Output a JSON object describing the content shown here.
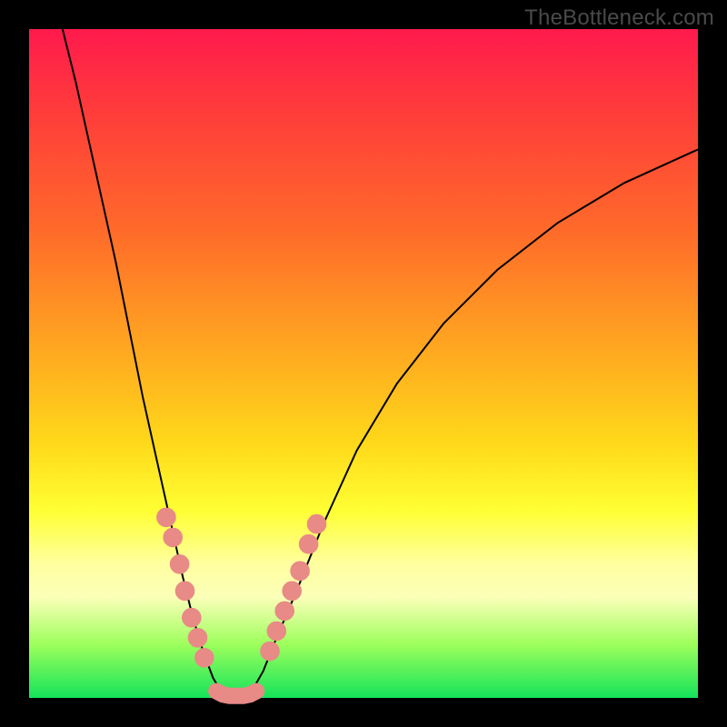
{
  "watermark": "TheBottleneck.com",
  "colors": {
    "frame": "#000000",
    "gradient_top": "#ff1a4d",
    "gradient_mid": "#ffd91a",
    "gradient_bottom": "#14e35a",
    "curve": "#000000",
    "dots": "#e88a86"
  },
  "chart_data": {
    "type": "line",
    "title": "",
    "xlabel": "",
    "ylabel": "",
    "xlim": [
      0,
      100
    ],
    "ylim": [
      0,
      100
    ],
    "series": [
      {
        "name": "left-curve",
        "x": [
          5,
          7,
          9,
          11,
          13,
          15,
          17,
          19,
          21,
          23,
          24.5,
          26,
          27.5,
          29
        ],
        "y": [
          100,
          92,
          83,
          74,
          65,
          55,
          45,
          36,
          27,
          18,
          12,
          7,
          3,
          0.5
        ]
      },
      {
        "name": "right-curve",
        "x": [
          33,
          35,
          37,
          40,
          44,
          49,
          55,
          62,
          70,
          79,
          89,
          100
        ],
        "y": [
          0.5,
          4,
          9,
          16,
          26,
          37,
          47,
          56,
          64,
          71,
          77,
          82
        ]
      }
    ],
    "valley_floor": {
      "x": [
        28,
        29,
        30,
        31,
        32,
        33,
        34
      ],
      "y": [
        1,
        0.5,
        0.3,
        0.3,
        0.3,
        0.5,
        1
      ]
    },
    "highlight_dots_left": [
      {
        "x": 20.5,
        "y": 27
      },
      {
        "x": 21.5,
        "y": 24
      },
      {
        "x": 22.5,
        "y": 20
      },
      {
        "x": 23.3,
        "y": 16
      },
      {
        "x": 24.3,
        "y": 12
      },
      {
        "x": 25.2,
        "y": 9
      },
      {
        "x": 26.2,
        "y": 6
      }
    ],
    "highlight_dots_right": [
      {
        "x": 36.0,
        "y": 7
      },
      {
        "x": 37.0,
        "y": 10
      },
      {
        "x": 38.2,
        "y": 13
      },
      {
        "x": 39.3,
        "y": 16
      },
      {
        "x": 40.5,
        "y": 19
      },
      {
        "x": 41.8,
        "y": 23
      },
      {
        "x": 43.0,
        "y": 26
      }
    ],
    "dot_radius_pct": 1.4
  }
}
